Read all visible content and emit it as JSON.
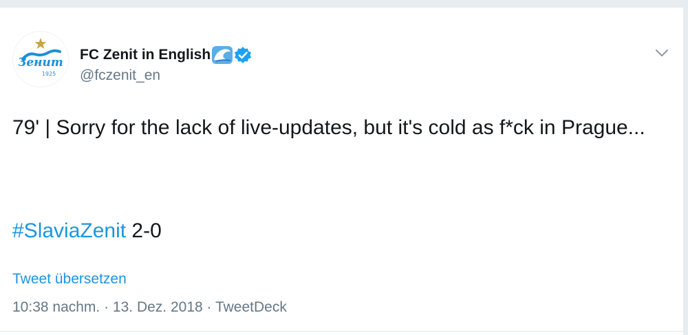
{
  "tweet": {
    "author": {
      "display_name": "FC Zenit in English",
      "handle": "@fczenit_en",
      "verified": true,
      "avatar_icon": "zenit-logo-icon",
      "avatar_year": "1925",
      "emoji_icon": "wave-icon"
    },
    "text_line": "79' | Sorry for the lack of live-updates, but it's cold as f*ck in Prague...",
    "hashtag": "#SlaviaZenit",
    "score": " 2-0",
    "translate_label": "Tweet übersetzen",
    "meta": "10:38 nachm. · 13. Dez. 2018 · TweetDeck"
  },
  "colors": {
    "link": "#1b95e0",
    "text": "#14171a",
    "secondary": "#657786",
    "verified": "#1da1f2",
    "background": "#e6ecf0"
  }
}
